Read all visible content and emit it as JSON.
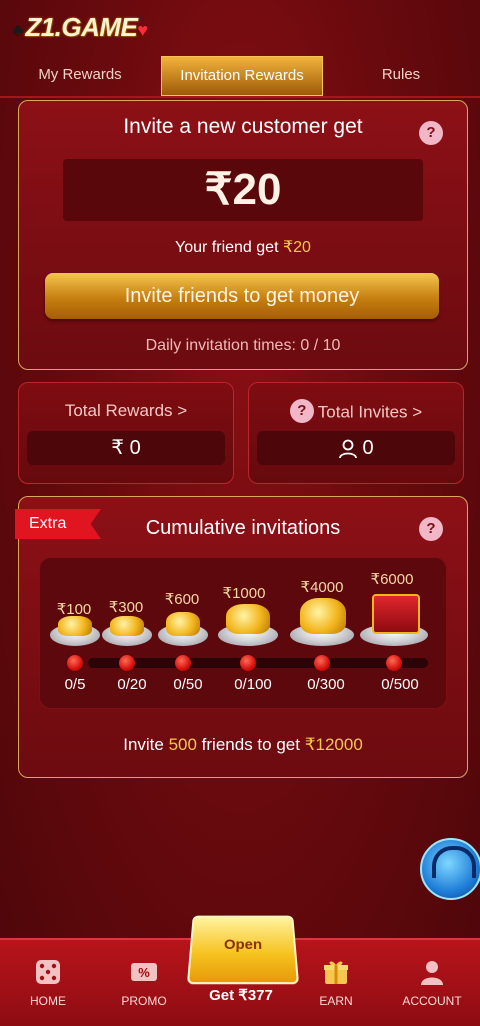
{
  "header": {
    "logo_text": "Z1.GAME"
  },
  "tabs": [
    {
      "label": "My Rewards",
      "active": false
    },
    {
      "label": "Invitation Rewards",
      "active": true
    },
    {
      "label": "Rules",
      "active": false
    }
  ],
  "invite": {
    "title": "Invite a new customer get",
    "amount": "₹20",
    "friend_prefix": "Your friend get ",
    "friend_amount": "₹20",
    "button_label": "Invite friends to get money",
    "daily_text": "Daily invitation times: 0 / 10"
  },
  "stats": {
    "total_rewards_label": "Total Rewards >",
    "total_rewards_value": "₹ 0",
    "total_invites_label": "Total Invites >",
    "total_invites_value": "0"
  },
  "cumulative": {
    "badge": "Extra",
    "title": "Cumulative invitations",
    "tiers": [
      {
        "reward": "₹100",
        "progress": "0/5"
      },
      {
        "reward": "₹300",
        "progress": "0/20"
      },
      {
        "reward": "₹600",
        "progress": "0/50"
      },
      {
        "reward": "₹1000",
        "progress": "0/100"
      },
      {
        "reward": "₹4000",
        "progress": "0/300"
      },
      {
        "reward": "₹6000",
        "progress": "0/500"
      }
    ],
    "footer_prefix": "Invite ",
    "footer_count": "500",
    "footer_middle": " friends to get ",
    "footer_amount": "₹12000"
  },
  "nav": {
    "home": "HOME",
    "promo": "PROMO",
    "center_open": "Open",
    "center_label": "Get ₹377",
    "earn": "EARN",
    "account": "ACCOUNT"
  },
  "colors": {
    "background": "#6a0a0e",
    "accent_gold": "#f6c64e",
    "nav_red": "#b8141b"
  },
  "icons": [
    "question-icon",
    "rupee-icon",
    "user-icon",
    "dice-icon",
    "percent-ticket-icon",
    "gift-icon",
    "account-icon",
    "support-agent-icon"
  ]
}
